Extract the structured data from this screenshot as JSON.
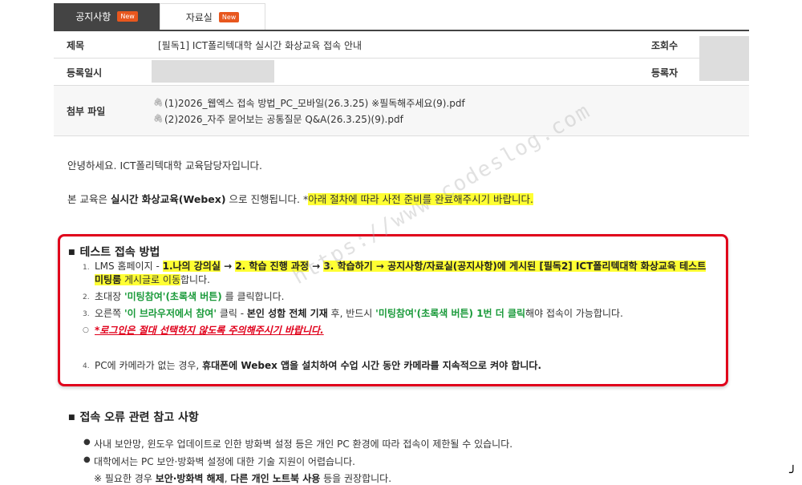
{
  "tabs": [
    {
      "label": "공지사항",
      "badge": "New"
    },
    {
      "label": "자료실",
      "badge": "New"
    }
  ],
  "info": {
    "title_label": "제목",
    "title_value": "[필독1] ICT폴리텍대학 실시간 화상교육 접속 안내",
    "views_label": "조회수",
    "date_label": "등록일시",
    "author_label": "등록자",
    "attach_label": "첨부 파일",
    "files": [
      "(1)2026_웹엑스 접속 방법_PC_모바일(26.3.25) ※필독해주세요(9).pdf",
      "(2)2026_자주 묻어보는 공통질문 Q&A(26.3.25)(9).pdf"
    ]
  },
  "body": {
    "greeting": "안녕하세요. ICT폴리텍대학 교육담당자입니다.",
    "intro_pre": "본 교육은 ",
    "intro_bold": "실시간 화상교육(Webex)",
    "intro_mid": " 으로 진행됩니다. *",
    "intro_hl": "아래 절차에 따라 사전 준비를 완료해주시기 바랍니다."
  },
  "test_section": {
    "title": "테스트 접속 방법",
    "s1_a": "LMS 홈페이지 - ",
    "s1_b": "1.나의 강의실",
    "s1_c": " → ",
    "s1_d": "2. 학습 진행 과정",
    "s1_e": " → ",
    "s1_f": "3. 학습하기",
    "s1_g": " → 공지사항/자료실(공지사항)에 게시된 ",
    "s1_h": "[필독2] ICT폴리텍대학 화상교육 테스트",
    "s1_i": "미팅룸",
    "s1_j": " 게시글로 이동",
    "s1_k": "합니다.",
    "s2_a": "초대장 ",
    "s2_b": "'미팅참여'(초록색 버튼)",
    "s2_c": " 를 클릭합니다.",
    "s3_a": "오른쪽 ",
    "s3_b": "'이 브라우저에서 참여'",
    "s3_c": " 클릭 - ",
    "s3_d": "본인 성함 전체 기재",
    "s3_e": " 후, 반드시 ",
    "s3_f": "'미팅참여'(초록색 버튼) 1번 더 클릭",
    "s3_g": "해야 접속이 가능합니다.",
    "warn": "*로그인은 절대 선택하지 않도록 주의해주시기 바랍니다.",
    "s4_a": "PC에 카메라가 없는 경우, ",
    "s4_b": "휴대폰에 Webex 앱을 설치하여 수업 시간 동안 카메라를 지속적으로 켜야 합니다.",
    "n1": "1.",
    "n2": "2.",
    "n3": "3.",
    "n4": "4.",
    "nw": "○"
  },
  "error_section": {
    "title": "접속 오류 관련 참고 사항",
    "b1": "사내 보안망, 윈도우 업데이트로 인한 방화벽 설정 등은 개인 PC 환경에 따라 접속이 제한될 수 있습니다.",
    "b2": "대학에서는 PC 보안·방화벽 설정에 대한 기술 지원이 어렵습니다.",
    "b3_a": "※ 필요한 경우 ",
    "b3_b": "보안·방화벽 해제",
    "b3_c": ", ",
    "b3_d": "다른 개인 노트북 사용",
    "b3_e": " 등을 권장합니다."
  },
  "watermark": "https://www.codeslog.com"
}
